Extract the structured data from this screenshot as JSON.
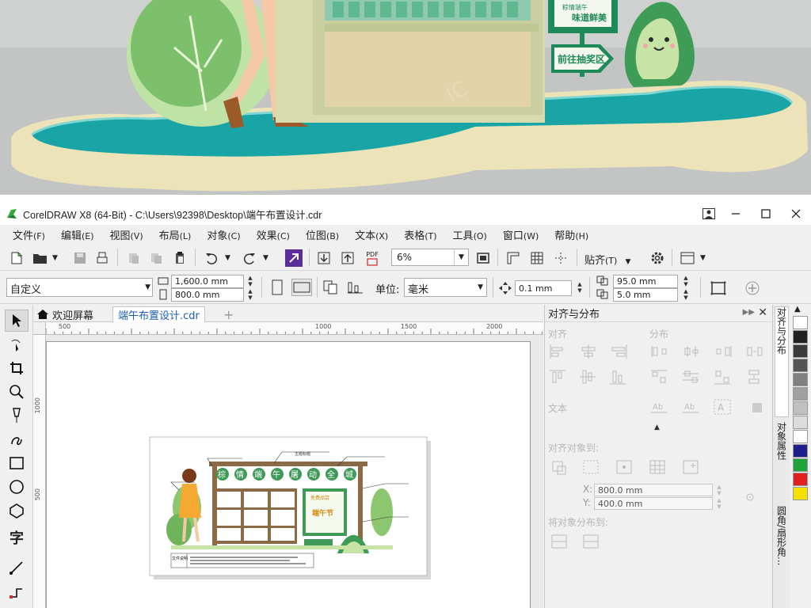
{
  "scene": {
    "sign_texts": [
      "粽情端午",
      "味道鲜美",
      "前往抽奖区"
    ]
  },
  "titlebar": {
    "title": "CorelDRAW X8 (64-Bit) - C:\\Users\\92398\\Desktop\\端午布置设计.cdr"
  },
  "menu": [
    {
      "label": "文件",
      "accel": "(F)"
    },
    {
      "label": "编辑",
      "accel": "(E)"
    },
    {
      "label": "视图",
      "accel": "(V)"
    },
    {
      "label": "布局",
      "accel": "(L)"
    },
    {
      "label": "对象",
      "accel": "(C)"
    },
    {
      "label": "效果",
      "accel": "(C)"
    },
    {
      "label": "位图",
      "accel": "(B)"
    },
    {
      "label": "文本",
      "accel": "(X)"
    },
    {
      "label": "表格",
      "accel": "(T)"
    },
    {
      "label": "工具",
      "accel": "(O)"
    },
    {
      "label": "窗口",
      "accel": "(W)"
    },
    {
      "label": "帮助",
      "accel": "(H)"
    }
  ],
  "toolbar": {
    "zoom": "6%",
    "pdf_label": "PDF",
    "snap_label": "贴齐",
    "snap_accel": "(T)"
  },
  "propbar": {
    "preset": "自定义",
    "width": "1,600.0 mm",
    "height": "800.0 mm",
    "unit_label": "单位:",
    "unit": "毫米",
    "nudge": "0.1 mm",
    "dup_x": "95.0 mm",
    "dup_y": "5.0 mm"
  },
  "tabs": {
    "welcome": "欢迎屏幕",
    "document": "端午布置设计.cdr"
  },
  "ruler": {
    "h_labels": [
      "500",
      "1000",
      "1500",
      "2000"
    ],
    "v_labels": [
      "1000",
      "500"
    ]
  },
  "artwork": {
    "heading_chars": [
      "棕",
      "情",
      "端",
      "午",
      "屠",
      "动",
      "全",
      "城"
    ],
    "heading_note": "主题标题",
    "board_title": "端午节",
    "board_sub": "免费品尝",
    "legend_title": "文件说明"
  },
  "docker": {
    "title": "对齐与分布",
    "align": "对齐",
    "distribute": "分布",
    "text": "文本",
    "align_to": "对齐对象到:",
    "x_label": "X:",
    "x_value": "800.0 mm",
    "y_label": "Y:",
    "y_value": "400.0 mm",
    "distribute_to": "将对象分布到:"
  },
  "docker_tabs": [
    "对齐与分布",
    "对象属性",
    "圆角/扇形角..."
  ],
  "palette": [
    "#ffffff",
    "#222222",
    "#3a3a3a",
    "#555555",
    "#808080",
    "#a0a0a0",
    "#c0c0c0",
    "#dcdcdc",
    "#ffffff",
    "#1e1e8c",
    "#1fa33a",
    "#e02020",
    "#f5e000"
  ]
}
